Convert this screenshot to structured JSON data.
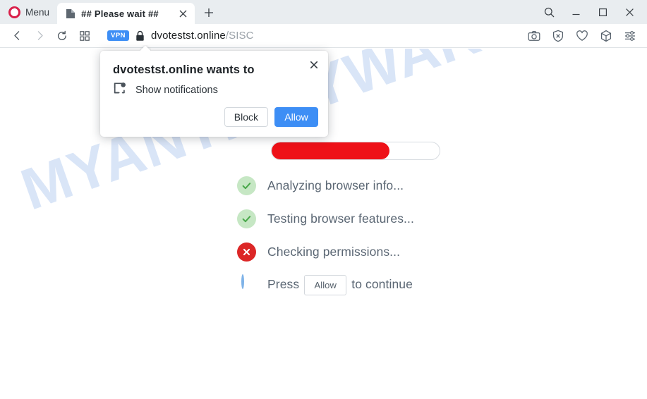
{
  "window": {
    "menu_label": "Menu",
    "opera_logo_icon": "opera-logo-icon",
    "search_icon": "search-icon",
    "minimize_icon": "minimize-icon",
    "maximize_icon": "maximize-icon",
    "close_icon": "close-icon"
  },
  "tabs": [
    {
      "title": "## Please wait ##",
      "favicon": "page-icon",
      "close_icon": "close-icon",
      "active": true
    }
  ],
  "newtab": {
    "icon": "plus-icon"
  },
  "navbar": {
    "back_icon": "back-arrow-icon",
    "forward_icon": "forward-arrow-icon",
    "reload_icon": "reload-icon",
    "tab_islands_icon": "grid-icon",
    "vpn_badge": "VPN",
    "lock_icon": "padlock-icon",
    "url_host": "dvotestst.online",
    "url_path": "/SISC",
    "right_icons": [
      {
        "name": "snapshot-camera-icon"
      },
      {
        "name": "ad-blocker-shield-icon"
      },
      {
        "name": "heart-icon"
      },
      {
        "name": "extensions-cube-icon"
      },
      {
        "name": "easy-setup-sliders-icon"
      }
    ]
  },
  "dialog": {
    "title": "dvotestst.online wants to",
    "permission_icon": "notification-bell-icon",
    "permission_label": "Show notifications",
    "block_label": "Block",
    "allow_label": "Allow",
    "close_icon": "close-icon",
    "accent_color": "#3d8ef5"
  },
  "page": {
    "watermark": "MYANTISPYWARE.COM",
    "watermark_color": "#d9e5f7",
    "progress": {
      "percent": 70,
      "fill_color": "#ee1118",
      "track_color": "#ffffff"
    },
    "checklist": [
      {
        "status": "ok",
        "icon": "check-circle-icon",
        "label": "Analyzing browser info...",
        "color": "#c6e7c4"
      },
      {
        "status": "ok",
        "icon": "check-circle-icon",
        "label": "Testing browser features...",
        "color": "#c6e7c4"
      },
      {
        "status": "error",
        "icon": "x-circle-icon",
        "label": "Checking permissions...",
        "color": "#dc2727"
      },
      {
        "status": "pending",
        "icon": "empty-circle-icon",
        "label_before": "Press",
        "inline_button": "Allow",
        "label_after": "to continue",
        "color": "#7fb3e8"
      }
    ]
  }
}
